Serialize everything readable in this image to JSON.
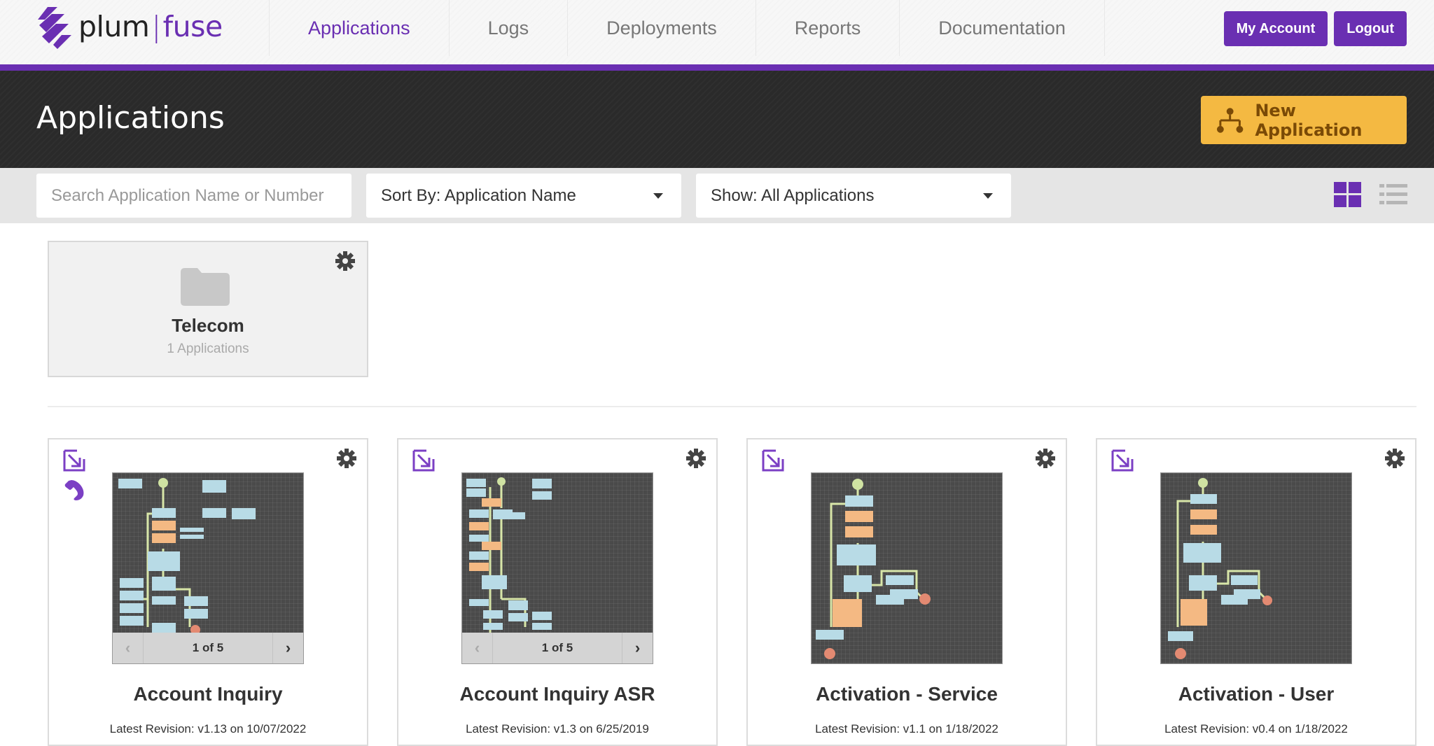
{
  "brand": {
    "name_left": "plum",
    "name_right": "fuse",
    "accent": "#6a2fb2"
  },
  "nav": {
    "items": [
      {
        "label": "Applications",
        "active": true
      },
      {
        "label": "Logs"
      },
      {
        "label": "Deployments"
      },
      {
        "label": "Reports"
      },
      {
        "label": "Documentation"
      }
    ],
    "my_account": "My Account",
    "logout": "Logout"
  },
  "header": {
    "title": "Applications",
    "new_app_label": "New Application",
    "new_app_color": "#f4b942"
  },
  "filters": {
    "search_placeholder": "Search Application Name or Number",
    "sort_label": "Sort By: Application Name",
    "show_label": "Show: All Applications",
    "view_mode": "grid"
  },
  "folders": [
    {
      "name": "Telecom",
      "count": "1 Applications"
    }
  ],
  "apps": [
    {
      "name": "Account Inquiry",
      "revision": "Latest Revision: v1.13 on 10/07/2022",
      "pager": "1 of 5",
      "has_phone": true
    },
    {
      "name": "Account Inquiry ASR",
      "revision": "Latest Revision: v1.3 on 6/25/2019",
      "pager": "1 of 5",
      "has_phone": false
    },
    {
      "name": "Activation - Service",
      "revision": "Latest Revision: v1.1 on 1/18/2022",
      "has_phone": false
    },
    {
      "name": "Activation - User",
      "revision": "Latest Revision: v0.4 on 1/18/2022",
      "has_phone": false
    }
  ]
}
